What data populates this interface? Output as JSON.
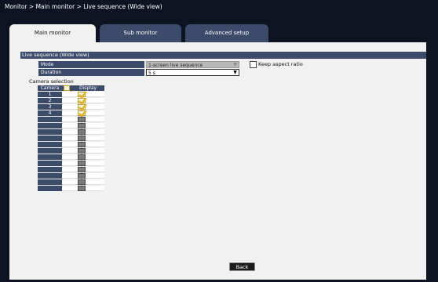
{
  "breadcrumb": "Monitor > Main monitor > Live sequence (Wide view)",
  "tabs": [
    {
      "label": "Main monitor",
      "active": true
    },
    {
      "label": "Sub monitor",
      "active": false
    },
    {
      "label": "Advanced setup",
      "active": false
    }
  ],
  "section": {
    "title": "Live sequence (Wide view)",
    "mode": {
      "label": "Mode",
      "value": "1-screen live sequence",
      "disabled": true
    },
    "duration": {
      "label": "Duration",
      "value": "5 s"
    },
    "keep_aspect": {
      "label": "Keep aspect ratio",
      "checked": false
    }
  },
  "camera_selection": {
    "label": "Camera selection",
    "header_camera": "Camera",
    "header_display": "Display",
    "header_check_all": true,
    "rows": [
      {
        "camera": "1",
        "display": true
      },
      {
        "camera": "2",
        "display": true
      },
      {
        "camera": "3",
        "display": true
      },
      {
        "camera": "4",
        "display": true
      },
      {
        "camera": "",
        "display": false
      },
      {
        "camera": "",
        "display": false
      },
      {
        "camera": "",
        "display": false
      },
      {
        "camera": "",
        "display": false
      },
      {
        "camera": "",
        "display": false
      },
      {
        "camera": "",
        "display": false
      },
      {
        "camera": "",
        "display": false
      },
      {
        "camera": "",
        "display": false
      },
      {
        "camera": "",
        "display": false
      },
      {
        "camera": "",
        "display": false
      },
      {
        "camera": "",
        "display": false
      },
      {
        "camera": "",
        "display": false
      }
    ]
  },
  "back_label": "Back",
  "colors": {
    "header": "#3d4b6b",
    "background": "#0d1321",
    "panel": "#f1f1f1",
    "checked": "#e0b020"
  }
}
